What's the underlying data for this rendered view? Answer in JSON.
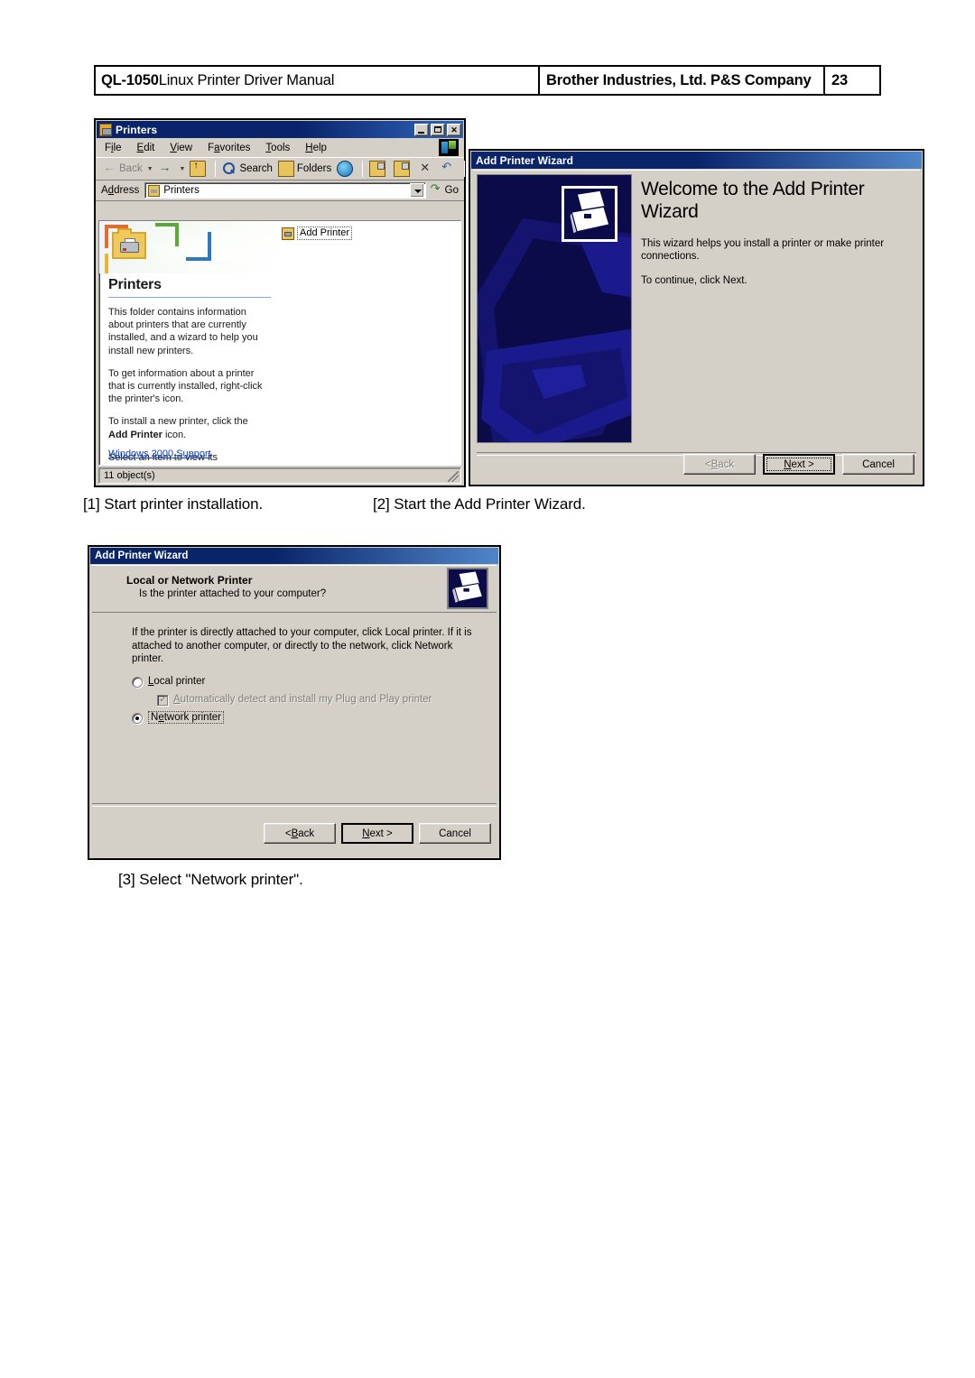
{
  "page_header": {
    "manual_title_prefix": "QL-1050",
    "manual_title": " Linux Printer Driver Manual",
    "company": "Brother Industries, Ltd. P&S Company",
    "page_number": "23"
  },
  "window_printers": {
    "title": "Printers",
    "title_icon": "printers-folder-icon",
    "controls": {
      "minimize": "minimize-button",
      "maximize": "maximize-button",
      "close": "close-button"
    },
    "menu": [
      {
        "pre": "F",
        "key": "i",
        "post": "le"
      },
      {
        "pre": "",
        "key": "E",
        "post": "dit"
      },
      {
        "pre": "",
        "key": "V",
        "post": "iew"
      },
      {
        "pre": "F",
        "key": "a",
        "post": "vorites"
      },
      {
        "pre": "",
        "key": "T",
        "post": "ools"
      },
      {
        "pre": "",
        "key": "H",
        "post": "elp"
      }
    ],
    "toolbar": {
      "back": "Back",
      "search": "Search",
      "folders": "Folders"
    },
    "address": {
      "label_pre": "A",
      "label_key": "d",
      "label_post": "dress",
      "value": "Printers",
      "go": "Go"
    },
    "banner_title": "Printers",
    "description": [
      "This folder contains information about printers that are currently installed, and a wizard to help you install new printers.",
      "To get information about a printer that is currently installed, right-click the printer's icon.",
      "Select an item to view its description."
    ],
    "description_bold_line_pre": "To install a new printer, click the ",
    "description_bold_line_bold": "Add Printer",
    "description_bold_line_post": " icon.",
    "support_link": "Windows 2000 Support",
    "file_item": "Add Printer",
    "status": "11 object(s)"
  },
  "window_wizard_welcome": {
    "title": "Add Printer Wizard",
    "heading": "Welcome to the Add Printer Wizard",
    "paragraph1": "This wizard helps you install a printer or make printer connections.",
    "paragraph2": "To continue, click Next.",
    "buttons": {
      "back_pre": "< ",
      "back_key": "B",
      "back_post": "ack",
      "next_pre": "",
      "next_key": "N",
      "next_post": "ext >",
      "cancel": "Cancel"
    }
  },
  "window_local_or_network": {
    "title": "Add Printer Wizard",
    "page_title": "Local or Network Printer",
    "page_subtitle": "Is the printer attached to your computer?",
    "intro": "If the printer is directly attached to your computer, click Local printer.  If it is attached to another computer, or directly to the network, click Network printer.",
    "options": [
      {
        "key": "L",
        "post": "ocal printer",
        "pre": "",
        "type": "radio",
        "selected": false,
        "disabled": false
      },
      {
        "key": "A",
        "post": "utomatically detect and install my Plug and Play printer",
        "pre": "",
        "type": "checkbox",
        "selected": true,
        "disabled": true
      },
      {
        "key": "N",
        "post": "etwork printer",
        "pre": "",
        "type": "radio",
        "selected": true,
        "disabled": false
      }
    ],
    "buttons": {
      "back_pre": "< ",
      "back_key": "B",
      "back_post": "ack",
      "next_pre": "",
      "next_key": "N",
      "next_post": "ext >",
      "cancel": "Cancel"
    }
  },
  "captions": {
    "c1": "[1]  Start printer installation.",
    "c2": "[2] Start the Add Printer Wizard.",
    "c3": "[3] Select \"Network printer\"."
  },
  "colors": {
    "titlebar_blue": "#0a246a",
    "window_face": "#d4d0c8",
    "wizard_panel": "#0b0b4a",
    "link_blue": "#0b3fbf"
  }
}
